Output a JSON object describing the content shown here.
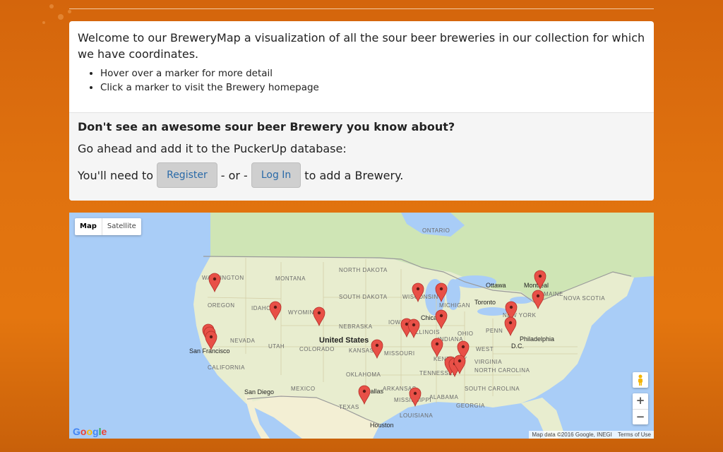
{
  "intro": {
    "welcome_text": "Welcome to our BreweryMap a visualization of all the sour beer breweries in our collection for which we have coordinates.",
    "tips": [
      "Hover over a marker for more detail",
      "Click a marker to visit the Brewery homepage"
    ]
  },
  "add_brewery": {
    "headline": "Don't see an awesome sour beer Brewery you know about?",
    "subline": "Go ahead and add it to the PuckerUp database:",
    "need_prefix": "You'll need to",
    "register_label": "Register",
    "or_text": "- or -",
    "login_label": "Log In",
    "need_suffix": "to add a Brewery."
  },
  "map": {
    "type_map_label": "Map",
    "type_satellite_label": "Satellite",
    "zoom_in_label": "+",
    "zoom_out_label": "−",
    "google_logo_text": "Google",
    "attribution": "Map data ©2016 Google, INEGI",
    "terms_label": "Terms of Use",
    "marker_color": "#e85047",
    "labels": {
      "ontario": "ONTARIO",
      "washington": "WASHINGTON",
      "montana": "MONTANA",
      "north_dakota": "NORTH\nDAKOTA",
      "south_dakota": "SOUTH\nDAKOTA",
      "oregon": "OREGON",
      "idaho": "IDAHO",
      "wyoming": "WYOMING",
      "nevada": "NEVADA",
      "utah": "UTAH",
      "colorado": "COLORADO",
      "nebraska": "NEBRASKA",
      "kansas": "KANSAS",
      "missouri": "MISSOURI",
      "iowa": "IOWA",
      "wisconsin": "WISCONSIN",
      "michigan": "MICHIGAN",
      "illinois": "ILLINOIS",
      "indiana": "INDIANA",
      "ohio": "OHIO",
      "pennsylvania": "PENN",
      "new_york": "NEW YORK",
      "maine": "MAINE",
      "nova_scotia": "NOVA SCOTIA",
      "west_virginia": "WEST",
      "virginia": "VIRGINIA",
      "kentucky": "KENTUCKY",
      "tennessee": "TENNESSEE",
      "north_carolina": "NORTH\nCAROLINA",
      "south_carolina": "SOUTH\nCAROLINA",
      "oklahoma": "OKLAHOMA",
      "arkansas": "ARKANSAS",
      "mississippi": "MISSISSIPPI",
      "alabama": "ALABAMA",
      "georgia": "GEORGIA",
      "louisiana": "LOUISIANA",
      "texas": "TEXAS",
      "california": "CALIFORNIA",
      "united_states": "United States",
      "mexico": "MEXICO",
      "san_francisco": "San Francisco",
      "san_diego": "San Diego",
      "dallas": "Dallas",
      "houston": "Houston",
      "chicago": "Chicago",
      "toronto": "Toronto",
      "ottawa": "Ottawa",
      "montreal": "Montreal",
      "philadelphia": "Philadelphia",
      "dc": "D.C."
    }
  }
}
